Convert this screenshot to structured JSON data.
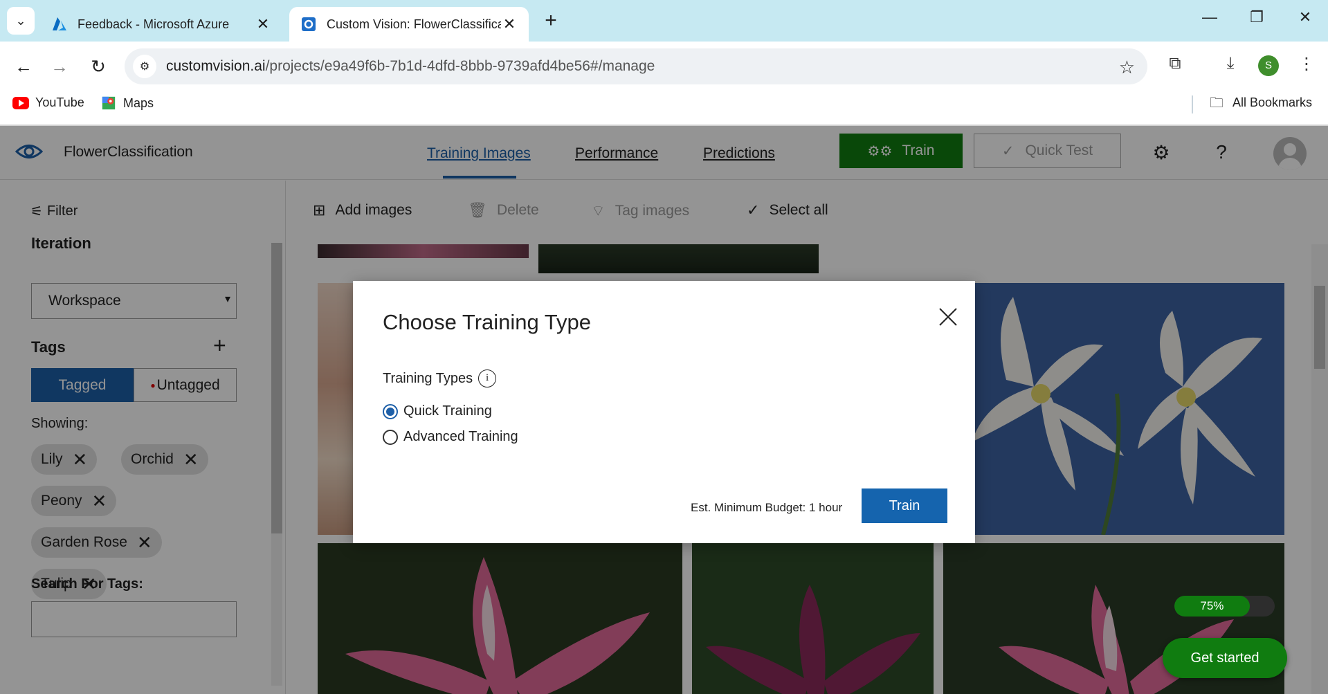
{
  "browser": {
    "tabs": [
      {
        "title": "Feedback - Microsoft Azure",
        "icon": "azure-icon",
        "active": false
      },
      {
        "title": "Custom Vision: FlowerClassifica",
        "icon": "custom-vision-icon",
        "active": true
      }
    ],
    "url_host": "customvision.ai",
    "url_path": "/projects/e9a49f6b-7b1d-4dfd-8bbb-9739afd4be56#/manage",
    "profile_initial": "S",
    "bookmarks": [
      {
        "label": "YouTube",
        "icon": "youtube-icon"
      },
      {
        "label": "Maps",
        "icon": "maps-icon"
      }
    ],
    "all_bookmarks": "All Bookmarks"
  },
  "app": {
    "project_name": "FlowerClassification",
    "tabs": [
      {
        "label": "Training Images",
        "active": true
      },
      {
        "label": "Performance",
        "active": false
      },
      {
        "label": "Predictions",
        "active": false
      }
    ],
    "train_label": "Train",
    "quick_test_label": "Quick Test"
  },
  "sidebar": {
    "filter_label": "Filter",
    "iteration_heading": "Iteration",
    "iteration_value": "Workspace",
    "tags_heading": "Tags",
    "tagged_label": "Tagged",
    "untagged_label": "Untagged",
    "showing_label": "Showing:",
    "tags": [
      "Lily",
      "Orchid",
      "Peony",
      "Garden Rose",
      "Tulip"
    ],
    "search_label": "Search For Tags:",
    "search_value": ""
  },
  "toolbar": {
    "add_images": "Add images",
    "delete": "Delete",
    "tag_images": "Tag images",
    "select_all": "Select all"
  },
  "dialog": {
    "title": "Choose Training Type",
    "types_label": "Training Types",
    "options": [
      {
        "label": "Quick Training",
        "checked": true
      },
      {
        "label": "Advanced Training",
        "checked": false
      }
    ],
    "budget": "Est. Minimum Budget: 1 hour",
    "train_label": "Train"
  },
  "widgets": {
    "progress_percent": 75,
    "progress_label": "75%",
    "get_started": "Get started"
  },
  "colors": {
    "accent_blue": "#1d5fa8",
    "train_green": "#107c10",
    "tabbar": "#c6e9f2"
  }
}
